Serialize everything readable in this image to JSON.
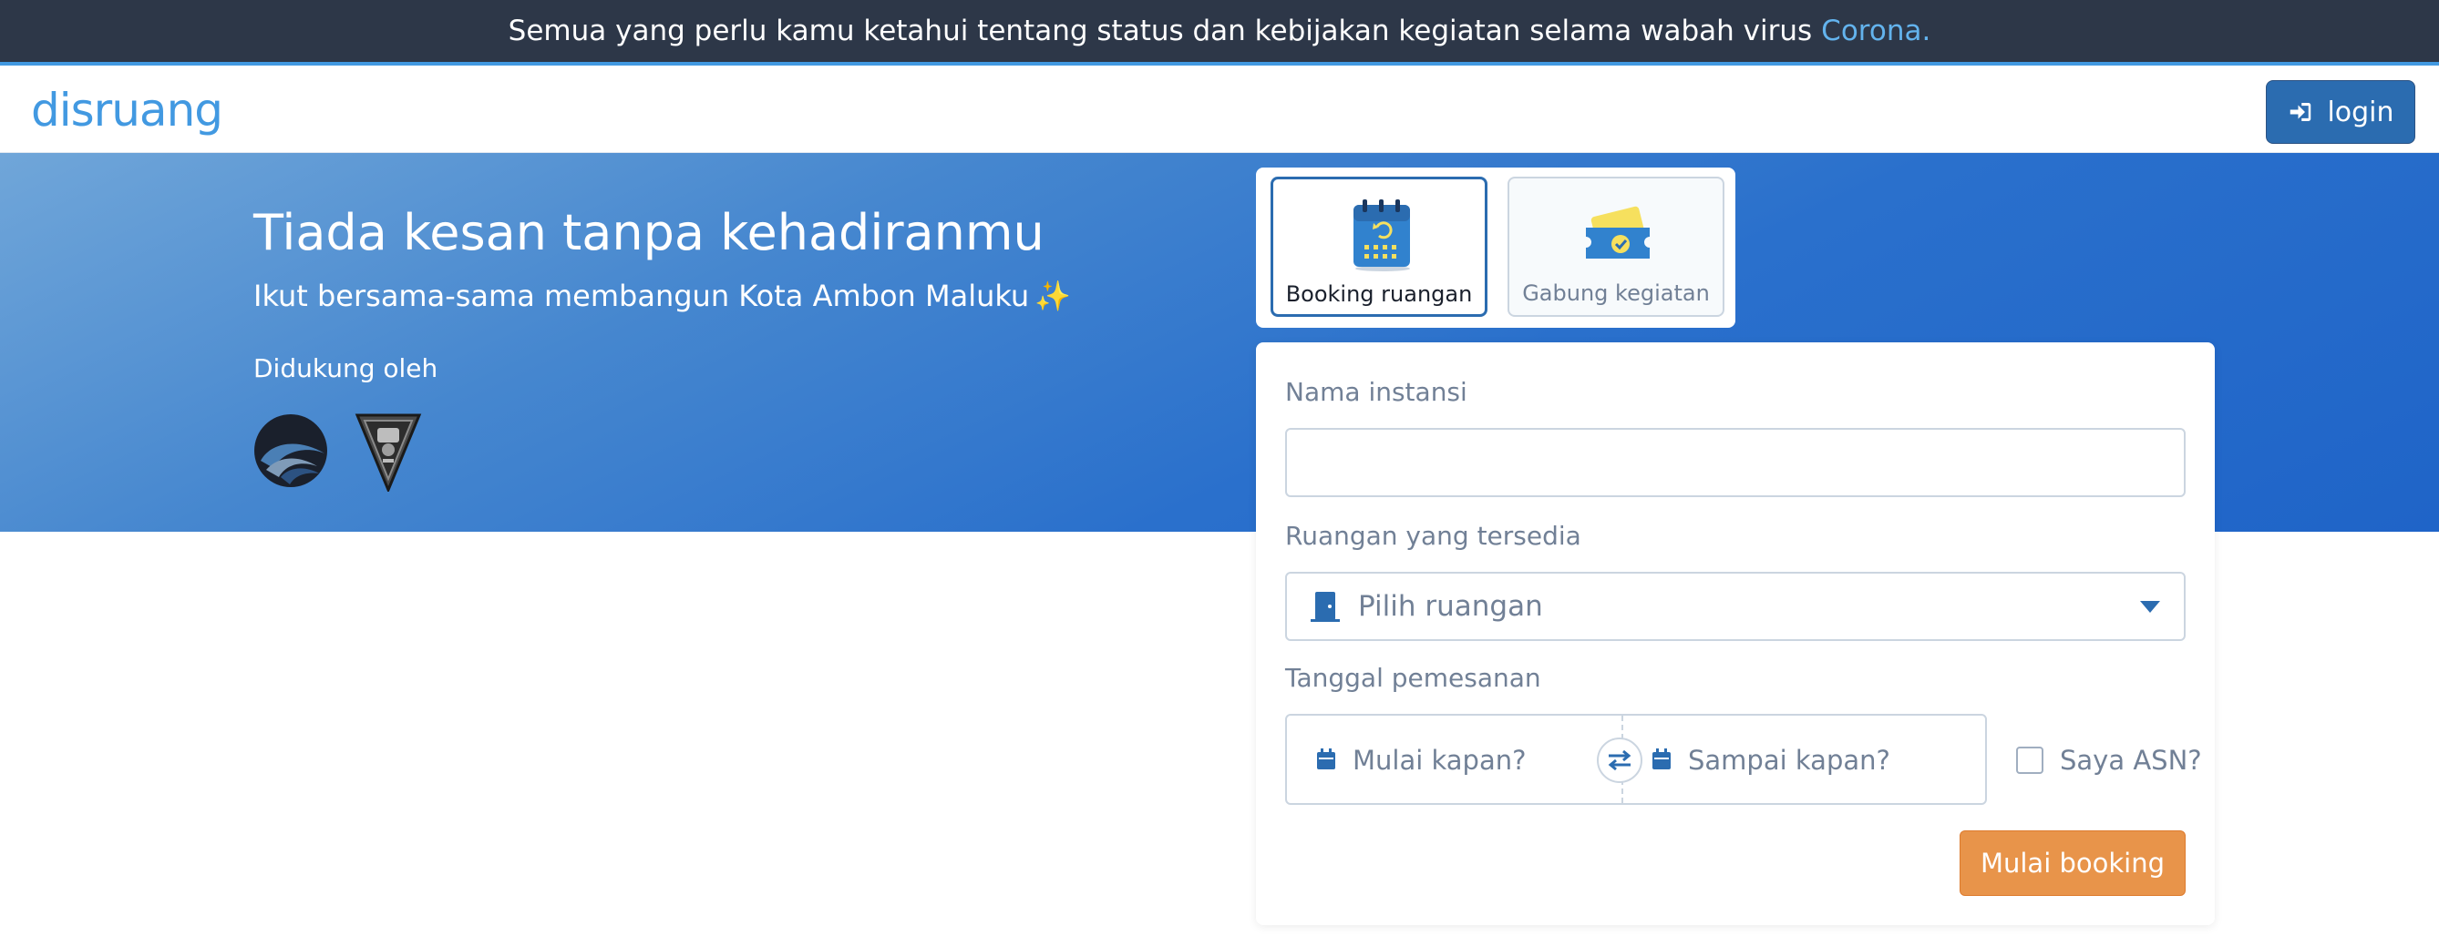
{
  "announcement": {
    "text": "Semua yang perlu kamu ketahui tentang status dan kebijakan kegiatan selama wabah virus",
    "link": "Corona."
  },
  "navbar": {
    "logo": "disruang",
    "login_label": "login",
    "login_icon": "sign-in-icon"
  },
  "hero": {
    "title": "Tiada kesan tanpa kehadiranmu",
    "subtitle": "Ikut bersama-sama membangun Kota Ambon Maluku",
    "subtitle_emoji": "✨",
    "supported_label": "Didukung oleh"
  },
  "tabs": [
    {
      "label": "Booking ruangan",
      "icon": "calendar-icon",
      "active": true
    },
    {
      "label": "Gabung kegiatan",
      "icon": "ticket-icon",
      "active": false
    }
  ],
  "form": {
    "instansi_label": "Nama instansi",
    "instansi_value": "",
    "ruangan_label": "Ruangan yang tersedia",
    "ruangan_placeholder": "Pilih ruangan",
    "tanggal_label": "Tanggal pemesanan",
    "start_placeholder": "Mulai kapan?",
    "end_placeholder": "Sampai kapan?",
    "asn_label": "Saya ASN?",
    "asn_checked": false,
    "submit_label": "Mulai booking"
  },
  "colors": {
    "primary": "#2b6cb0",
    "accent": "#4299e1",
    "cta": "#e8944a",
    "dark_bar": "#2d3748"
  }
}
